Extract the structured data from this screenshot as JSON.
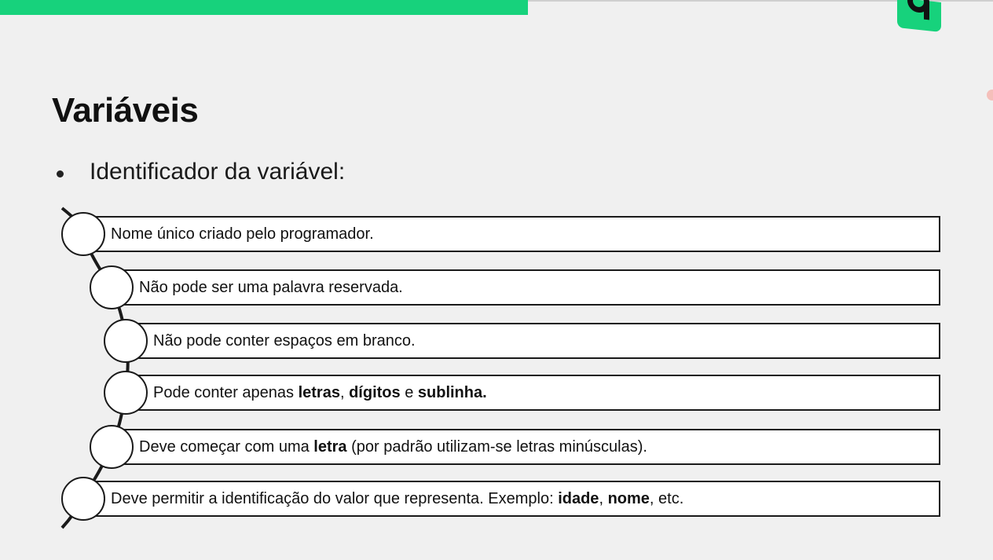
{
  "slide": {
    "title": "Variáveis",
    "bullet": "Identificador da variável:"
  },
  "items": [
    {
      "parts": [
        {
          "t": "Nome único criado pelo programador.",
          "b": false
        }
      ]
    },
    {
      "parts": [
        {
          "t": "Não pode ser uma palavra reservada.",
          "b": false
        }
      ]
    },
    {
      "parts": [
        {
          "t": "Não pode conter espaços em branco.",
          "b": false
        }
      ]
    },
    {
      "parts": [
        {
          "t": "Pode conter apenas ",
          "b": false
        },
        {
          "t": "letras",
          "b": true
        },
        {
          "t": ", ",
          "b": false
        },
        {
          "t": "dígitos",
          "b": true
        },
        {
          "t": " e ",
          "b": false
        },
        {
          "t": "sublinha.",
          "b": true
        }
      ]
    },
    {
      "parts": [
        {
          "t": "Deve começar com uma ",
          "b": false
        },
        {
          "t": "letra",
          "b": true
        },
        {
          "t": " (por padrão utilizam-se letras minúsculas).",
          "b": false
        }
      ]
    },
    {
      "parts": [
        {
          "t": "Deve permitir a identificação do valor que representa. Exemplo: ",
          "b": false
        },
        {
          "t": "idade",
          "b": true
        },
        {
          "t": ", ",
          "b": false
        },
        {
          "t": "nome",
          "b": true
        },
        {
          "t": ", etc.",
          "b": false
        }
      ]
    }
  ],
  "colors": {
    "accent": "#17d27c",
    "background": "#f0f0f0"
  },
  "icons": {
    "logo": "brand-logo-icon"
  }
}
